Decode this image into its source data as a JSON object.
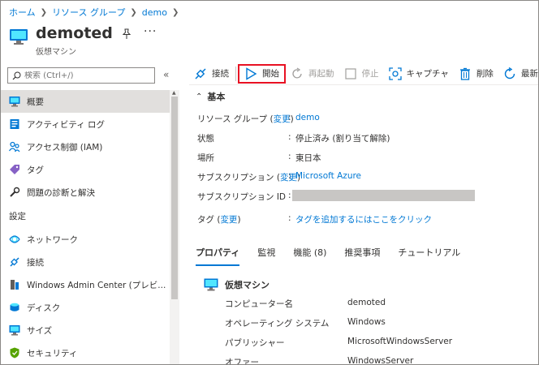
{
  "breadcrumb": [
    "ホーム",
    "リソース グループ",
    "demo"
  ],
  "header": {
    "title": "demoted",
    "subtitle": "仮想マシン"
  },
  "search": {
    "placeholder": "検索 (Ctrl+/)"
  },
  "sidebar": {
    "items": [
      {
        "label": "概要",
        "icon": "monitor-icon",
        "active": true
      },
      {
        "label": "アクティビティ ログ",
        "icon": "activity-log-icon"
      },
      {
        "label": "アクセス制御 (IAM)",
        "icon": "people-icon"
      },
      {
        "label": "タグ",
        "icon": "tag-icon"
      },
      {
        "label": "問題の診断と解決",
        "icon": "wrench-icon"
      }
    ],
    "section_label": "設定",
    "settings_items": [
      {
        "label": "ネットワーク",
        "icon": "network-icon"
      },
      {
        "label": "接続",
        "icon": "connect-icon"
      },
      {
        "label": "Windows Admin Center (プレビ...",
        "icon": "admin-center-icon"
      },
      {
        "label": "ディスク",
        "icon": "disk-icon"
      },
      {
        "label": "サイズ",
        "icon": "size-icon"
      },
      {
        "label": "セキュリティ",
        "icon": "shield-icon"
      }
    ]
  },
  "toolbar": {
    "connect": "接続",
    "start": "開始",
    "restart": "再起動",
    "stop": "停止",
    "capture": "キャプチャ",
    "delete": "削除",
    "refresh": "最新の"
  },
  "essentials": {
    "heading": "基本",
    "rows": [
      {
        "key": "リソース グループ",
        "key_link": "変更",
        "value": "demo",
        "value_is_link": true
      },
      {
        "key": "状態",
        "value": "停止済み (割り当て解除)"
      },
      {
        "key": "場所",
        "value": "東日本"
      },
      {
        "key": "サブスクリプション",
        "key_link": "変更",
        "value": "Microsoft Azure",
        "value_is_link": true
      },
      {
        "key": "サブスクリプション ID",
        "value": "",
        "redacted": true
      },
      {
        "key": "タグ",
        "key_link": "変更",
        "value": "タグを追加するにはここをクリック",
        "value_is_link": true
      }
    ]
  },
  "tabs": [
    "プロパティ",
    "監視",
    "機能 (8)",
    "推奨事項",
    "チュートリアル"
  ],
  "vm_section": {
    "title": "仮想マシン",
    "rows": [
      {
        "key": "コンピューター名",
        "value": "demoted"
      },
      {
        "key": "オペレーティング システム",
        "value": "Windows"
      },
      {
        "key": "パブリッシャー",
        "value": "MicrosoftWindowsServer"
      },
      {
        "key": "オファー",
        "value": "WindowsServer"
      }
    ]
  },
  "colors": {
    "accent": "#0078d4",
    "highlight_border": "#e81123"
  }
}
